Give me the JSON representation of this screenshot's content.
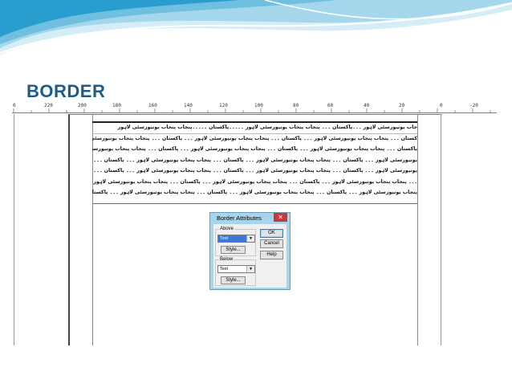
{
  "slide": {
    "title": "BORDER"
  },
  "ruler": {
    "labels": [
      "0",
      "220",
      "200",
      "180",
      "160",
      "140",
      "120",
      "100",
      "80",
      "60",
      "40",
      "20",
      "0",
      "-20"
    ]
  },
  "document": {
    "lines": [
      "جاب یونیورسٹی لاہور ۔۔۔پاکستان ۔۔۔ پنجاب پنجاب یونیورسٹی لاہور ۔۔۔۔۔پاکستان ۔۔۔۔۔پنجاب پنجاب یونیورسٹی لاہور",
      "کستان ۔۔۔ پنجاب پنجاب یونیورسٹی لاہور ۔۔۔ پاکستان ۔۔۔ پنجاب پنجاب یونیورسٹی لاہور ۔۔۔ پاکستان ۔۔۔ پنجاب پنجاب یونیورسٹی لاہور",
      "پاکستان ۔۔۔ پنجاب پنجاب یونیورسٹی لاہور ۔۔۔ پاکستان ۔۔۔ پنجاب پنجاب یونیورسٹی لاہور ۔۔۔ پاکستان ۔۔۔ پنجاب پنجاب یونیورسٹی لاہور ۔۔",
      "یونیورسٹی لاہور ۔۔۔ پاکستان ۔۔۔ پنجاب پنجاب یونیورسٹی لاہور ۔۔۔ پاکستان ۔۔۔ پنجاب پنجاب یونیورسٹی لاہور ۔۔۔ پاکستان ۔۔۔ پنجاب پنجاب",
      "یونیورسٹی لاہور ۔۔۔ پاکستان ۔۔۔ پنجاب پنجاب یونیورسٹی لاہور ۔۔۔ پاکستان ۔۔۔ پنجاب پنجاب یونیورسٹی لاہور ۔۔۔ پاکستان ۔۔۔ پنجاب پنجاب",
      "۔۔۔ پنجاب پنجاب یونیورسٹی لاہور ۔۔۔ پاکستان ۔۔۔ پنجاب پنجاب یونیورسٹی لاہور ۔۔۔ پاکستان ۔۔۔ پنجاب پنجاب یونیورسٹی لاہور ۔۔۔ پاکستان",
      "پنجاب یونیورسٹی لاہور ۔۔۔ پاکستان ۔۔۔ پنجاب پنجاب یونیورسٹی لاہور ۔۔۔ پاکستان ۔۔۔ پنجاب پنجاب یونیورسٹی لاہور ۔۔۔ پاکستان"
    ]
  },
  "dialog": {
    "title": "Border Attributes",
    "close_glyph": "✕",
    "above_label": "Above",
    "above_value": "Text",
    "above_style_button": "Style...",
    "below_label": "Below",
    "below_value": "Text",
    "below_style_button": "Style...",
    "ok_button": "OK",
    "cancel_button": "Cancel",
    "help_button": "Help",
    "dropdown_glyph": "▼"
  },
  "colors": {
    "title": "#1f5b87",
    "swoosh_light": "#cde9f4",
    "swoosh_mid": "#7fc4e3",
    "swoosh_dark": "#1b93c6",
    "dialog_frame": "#a8d4ee",
    "close_button": "#c7383a"
  }
}
